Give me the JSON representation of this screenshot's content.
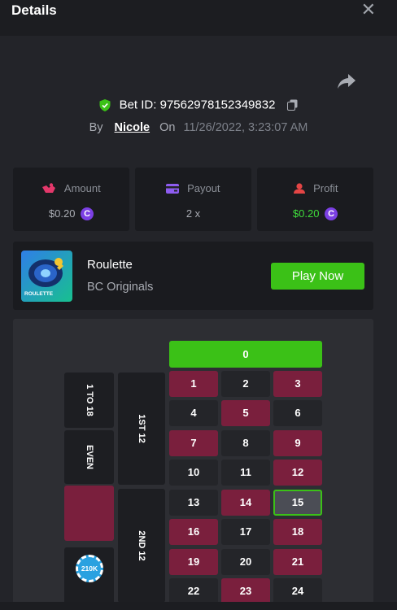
{
  "header": {
    "title": "Details",
    "close_glyph": "✕"
  },
  "bet": {
    "id_label": "Bet ID: 97562978152349832"
  },
  "by": {
    "prefix": "By",
    "user": "Nicole",
    "on": "On",
    "date": "11/26/2022, 3:23:07 AM"
  },
  "stats": [
    {
      "label": "Amount",
      "value": "$0.20",
      "icon": "amount-icon",
      "coin": "coin-icon"
    },
    {
      "label": "Payout",
      "value": "2 x",
      "icon": "payout-icon"
    },
    {
      "label": "Profit",
      "value": "$0.20",
      "icon": "profit-icon",
      "coin": "coin-icon"
    }
  ],
  "game": {
    "name": "Roulette",
    "provider": "BC Originals",
    "thumb_label": "ROULETTE",
    "play_label": "Play Now"
  },
  "board": {
    "zero": "0",
    "numbers": [
      "1",
      "2",
      "3",
      "4",
      "5",
      "6",
      "7",
      "8",
      "9",
      "10",
      "11",
      "12",
      "13",
      "14",
      "15",
      "16",
      "17",
      "18",
      "19",
      "20",
      "21",
      "22",
      "23",
      "24"
    ],
    "outside": {
      "low": "1 TO 18",
      "even": "EVEN",
      "first_dozen": "1ST 12",
      "second_dozen": "2ND 12"
    },
    "chip_label": "210K"
  },
  "colors": {
    "accent_green": "#3bc117",
    "red_number": "#7a1f3d",
    "black_number": "#242529",
    "profit_green": "#3fdc3b",
    "coin_purple": "#7b3fe4"
  }
}
